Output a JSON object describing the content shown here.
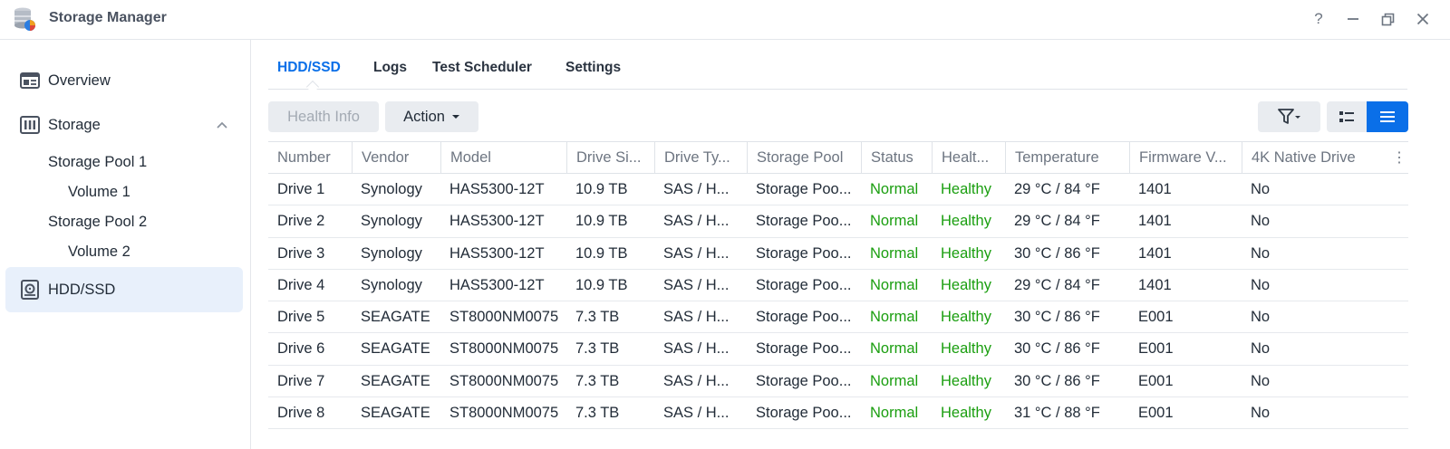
{
  "window": {
    "title": "Storage Manager",
    "controls": {
      "help": "?",
      "minimize": "—",
      "restore": "❐",
      "close": "✕"
    }
  },
  "sidebar": {
    "items": [
      {
        "label": "Overview",
        "icon": "overview-icon"
      },
      {
        "label": "Storage",
        "icon": "storage-icon",
        "expanded": true
      },
      {
        "label": "HDD/SSD",
        "icon": "hdd-icon",
        "active": true
      }
    ],
    "subitems": [
      {
        "label": "Storage Pool 1"
      },
      {
        "label": "Volume 1"
      },
      {
        "label": "Storage Pool 2"
      },
      {
        "label": "Volume 2"
      }
    ]
  },
  "tabs": [
    {
      "label": "HDD/SSD",
      "active": true
    },
    {
      "label": "Logs"
    },
    {
      "label": "Test Scheduler"
    },
    {
      "label": "Settings"
    }
  ],
  "toolbar": {
    "health_info": "Health Info",
    "action": "Action"
  },
  "colors": {
    "accent": "#0a6fe8",
    "ok": "#1a9e0f",
    "selected_nav": "#e8f0fb"
  },
  "table": {
    "headers": [
      "Number",
      "Vendor",
      "Model",
      "Drive Si...",
      "Drive Ty...",
      "Storage Pool",
      "Status",
      "Healt...",
      "Temperature",
      "Firmware V...",
      "4K Native Drive"
    ],
    "rows": [
      [
        "Drive 1",
        "Synology",
        "HAS5300-12T",
        "10.9 TB",
        "SAS / H...",
        "Storage Poo...",
        "Normal",
        "Healthy",
        "29 °C / 84 °F",
        "1401",
        "No"
      ],
      [
        "Drive 2",
        "Synology",
        "HAS5300-12T",
        "10.9 TB",
        "SAS / H...",
        "Storage Poo...",
        "Normal",
        "Healthy",
        "29 °C / 84 °F",
        "1401",
        "No"
      ],
      [
        "Drive 3",
        "Synology",
        "HAS5300-12T",
        "10.9 TB",
        "SAS / H...",
        "Storage Poo...",
        "Normal",
        "Healthy",
        "30 °C / 86 °F",
        "1401",
        "No"
      ],
      [
        "Drive 4",
        "Synology",
        "HAS5300-12T",
        "10.9 TB",
        "SAS / H...",
        "Storage Poo...",
        "Normal",
        "Healthy",
        "29 °C / 84 °F",
        "1401",
        "No"
      ],
      [
        "Drive 5",
        "SEAGATE",
        "ST8000NM0075",
        "7.3 TB",
        "SAS / H...",
        "Storage Poo...",
        "Normal",
        "Healthy",
        "30 °C / 86 °F",
        "E001",
        "No"
      ],
      [
        "Drive 6",
        "SEAGATE",
        "ST8000NM0075",
        "7.3 TB",
        "SAS / H...",
        "Storage Poo...",
        "Normal",
        "Healthy",
        "30 °C / 86 °F",
        "E001",
        "No"
      ],
      [
        "Drive 7",
        "SEAGATE",
        "ST8000NM0075",
        "7.3 TB",
        "SAS / H...",
        "Storage Poo...",
        "Normal",
        "Healthy",
        "30 °C / 86 °F",
        "E001",
        "No"
      ],
      [
        "Drive 8",
        "SEAGATE",
        "ST8000NM0075",
        "7.3 TB",
        "SAS / H...",
        "Storage Poo...",
        "Normal",
        "Healthy",
        "31 °C / 88 °F",
        "E001",
        "No"
      ]
    ]
  }
}
